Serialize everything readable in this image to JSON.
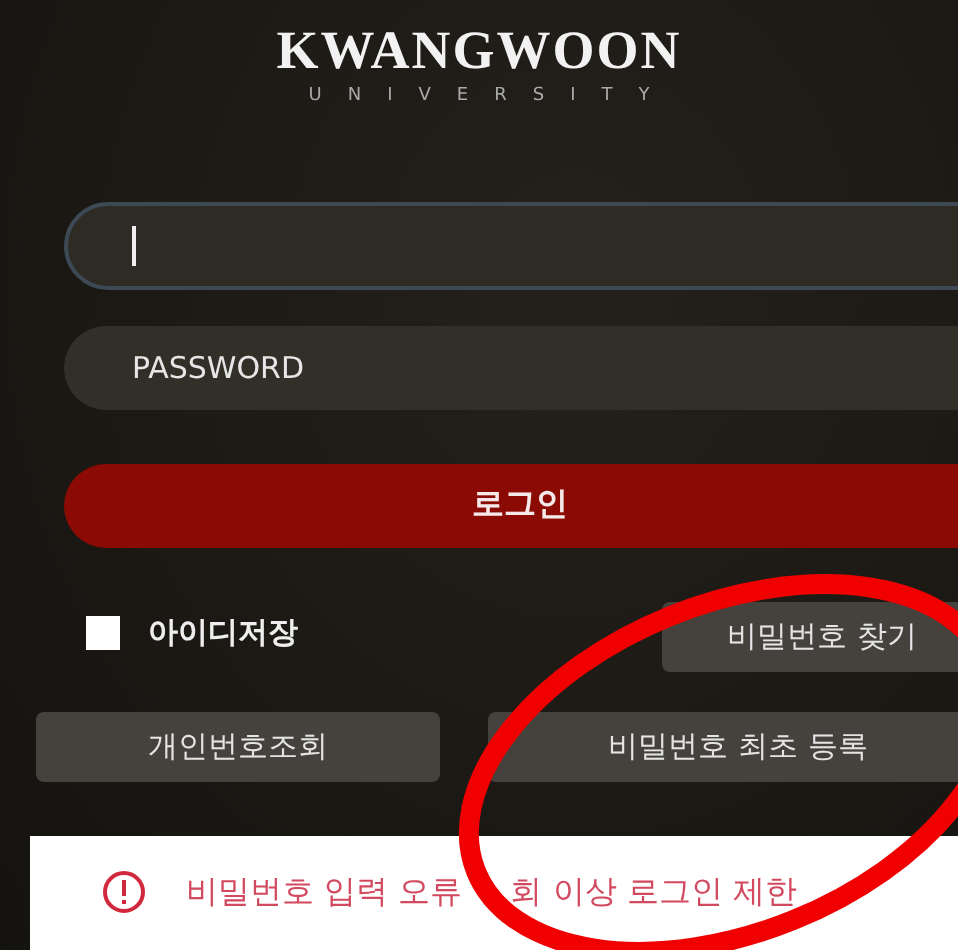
{
  "logo": {
    "name": "KWANGWOON",
    "subtitle": "UNIVERSITY"
  },
  "id_field": {
    "focused": true
  },
  "password_field": {
    "placeholder": "PASSWORD"
  },
  "login_button": {
    "label": "로그인"
  },
  "remember_id": {
    "label": "아이디저장",
    "checked": false
  },
  "find_password_button": {
    "label": "비밀번호 찾기"
  },
  "buttons": [
    {
      "label": "개인번호조회"
    },
    {
      "label": "비밀번호 최초 등록"
    }
  ],
  "notice": {
    "segments": [
      "비밀번호 입력 오류",
      "회 이상 로그인 제한"
    ]
  }
}
